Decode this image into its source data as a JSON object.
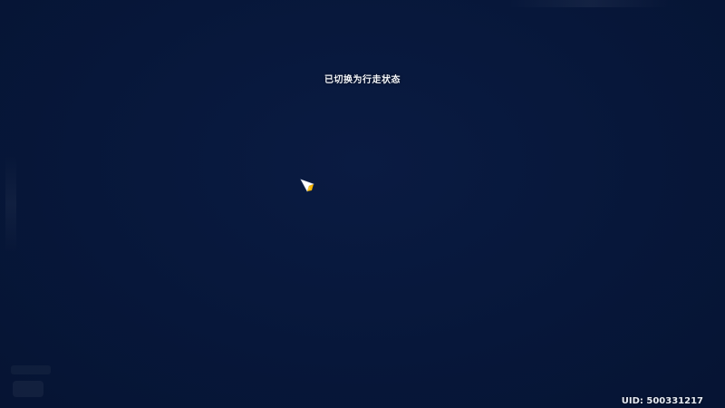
{
  "screen": {
    "background_color": "#07173a"
  },
  "notification": {
    "text": "已切换为行走状态"
  },
  "player_marker": {
    "icon": "player-arrow-icon",
    "color": "#f5b400"
  },
  "footer": {
    "uid_text": "UID: 500331217"
  }
}
